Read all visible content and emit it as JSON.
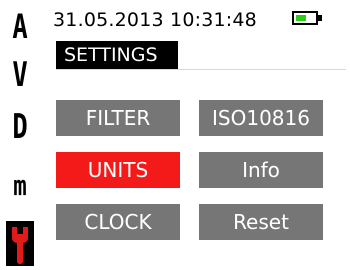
{
  "header": {
    "datetime": "31.05.2013 10:31:48",
    "section_title": "SETTINGS",
    "battery_level": 0.55
  },
  "side_menu": {
    "items": [
      {
        "label": "A"
      },
      {
        "label": "V"
      },
      {
        "label": "D"
      },
      {
        "label": "m"
      },
      {
        "icon": "wrench-icon",
        "selected": true
      }
    ]
  },
  "buttons": {
    "filter": "FILTER",
    "iso": "ISO10816",
    "units": "UNITS",
    "info": "Info",
    "clock": "CLOCK",
    "reset": "Reset"
  },
  "colors": {
    "selected": "#f51a1a",
    "button": "#767676",
    "battery_fill": "#2ecc1a",
    "icon_red": "#e11a1a"
  }
}
